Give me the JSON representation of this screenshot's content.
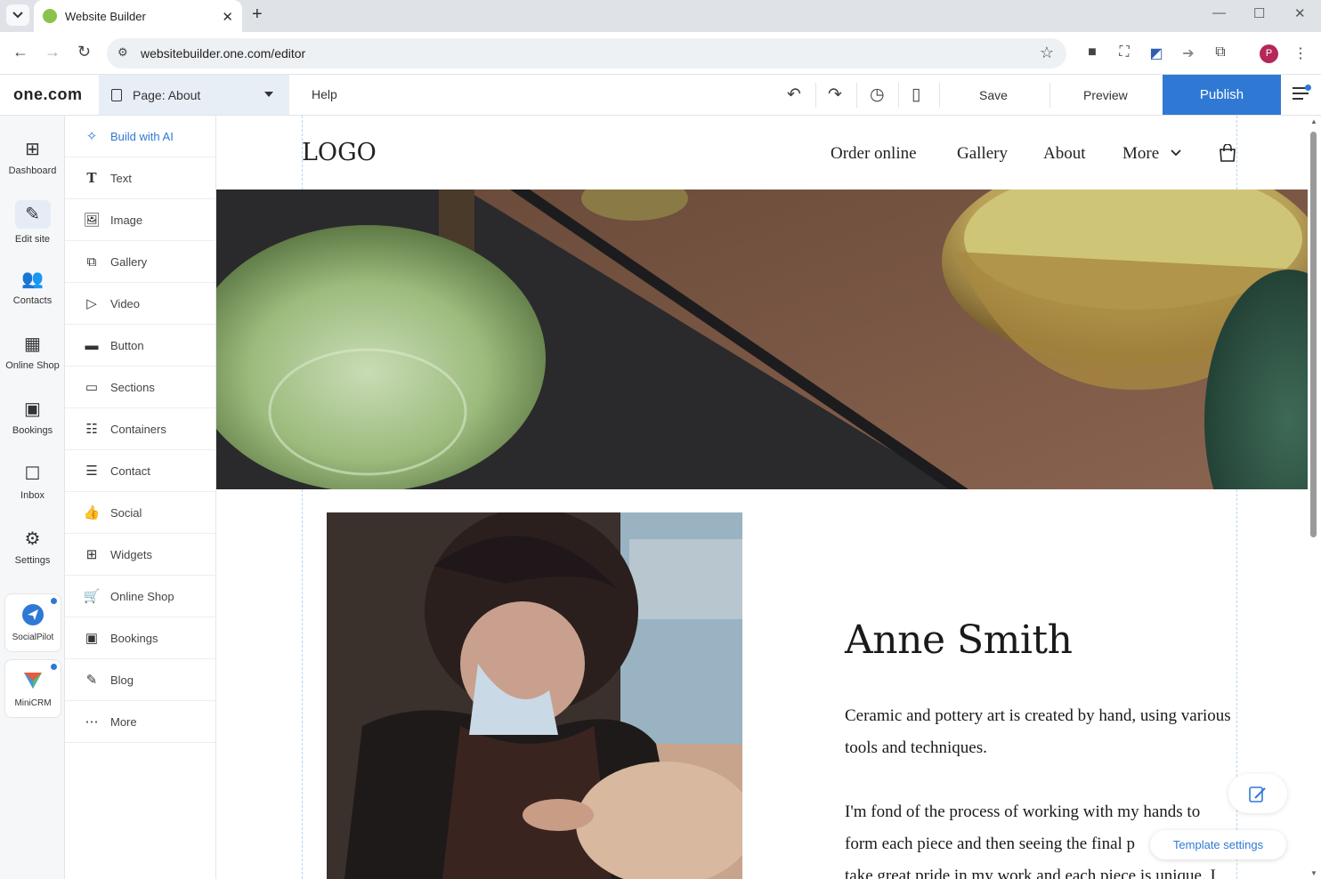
{
  "browser": {
    "tab_title": "Website Builder",
    "url": "websitebuilder.one.com/editor",
    "profile_initial": "P"
  },
  "editor": {
    "brand": "one.com",
    "page_selector": "Page: About",
    "help": "Help",
    "save": "Save",
    "preview": "Preview",
    "publish": "Publish",
    "accent_color": "#2f79d5"
  },
  "rail": {
    "items": [
      {
        "label": "Dashboard",
        "icon": "grid-icon"
      },
      {
        "label": "Edit site",
        "icon": "edit-site-icon"
      },
      {
        "label": "Contacts",
        "icon": "contacts-icon"
      },
      {
        "label": "Online Shop",
        "icon": "shop-icon"
      },
      {
        "label": "Bookings",
        "icon": "calendar-icon"
      },
      {
        "label": "Inbox",
        "icon": "inbox-icon"
      },
      {
        "label": "Settings",
        "icon": "gear-icon"
      }
    ],
    "cards": [
      {
        "label": "SocialPilot",
        "icon": "socialpilot-icon"
      },
      {
        "label": "MiniCRM",
        "icon": "minicrm-icon"
      }
    ]
  },
  "panel": {
    "items": [
      {
        "label": "Build with AI",
        "icon": "sparkle-icon"
      },
      {
        "label": "Text",
        "icon": "text-icon"
      },
      {
        "label": "Image",
        "icon": "image-icon"
      },
      {
        "label": "Gallery",
        "icon": "gallery-icon"
      },
      {
        "label": "Video",
        "icon": "video-icon"
      },
      {
        "label": "Button",
        "icon": "button-icon"
      },
      {
        "label": "Sections",
        "icon": "sections-icon"
      },
      {
        "label": "Containers",
        "icon": "containers-icon"
      },
      {
        "label": "Contact",
        "icon": "contact-form-icon"
      },
      {
        "label": "Social",
        "icon": "thumbs-up-icon"
      },
      {
        "label": "Widgets",
        "icon": "widgets-icon"
      },
      {
        "label": "Online Shop",
        "icon": "cart-icon"
      },
      {
        "label": "Bookings",
        "icon": "calendar-icon"
      },
      {
        "label": "Blog",
        "icon": "blog-icon"
      },
      {
        "label": "More",
        "icon": "more-icon"
      }
    ]
  },
  "site": {
    "logo": "LOGO",
    "nav": [
      "Order online",
      "Gallery",
      "About",
      "More"
    ],
    "name": "Anne Smith",
    "para1": "Ceramic and pottery art is created by hand, using various tools and techniques.",
    "para2_l1": "I'm fond of the process of working with my hands to",
    "para2_l2": "form each piece and then seeing the final p",
    "para2_l3": "take great pride in my work and each piece is unique. I"
  },
  "template_settings": "Template settings"
}
